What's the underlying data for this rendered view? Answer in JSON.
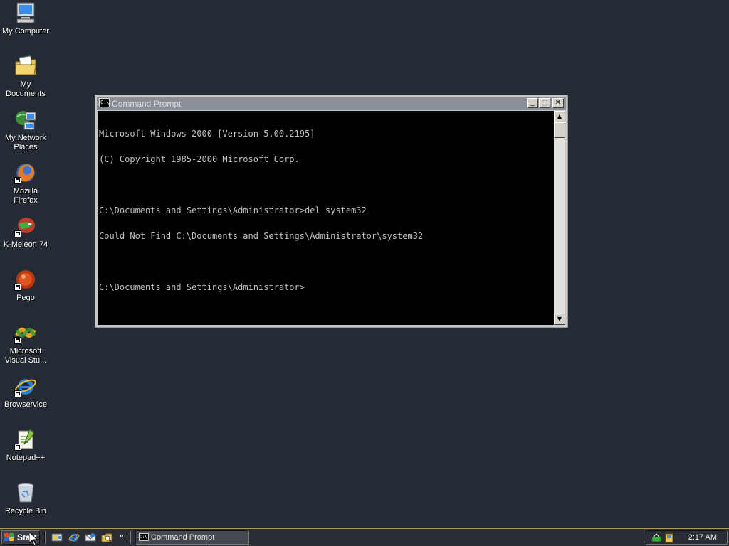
{
  "desktop": {
    "icons": [
      {
        "label": "My Computer",
        "icon": "my-computer-icon"
      },
      {
        "label": "My Documents",
        "icon": "my-documents-icon"
      },
      {
        "label": "My Network Places",
        "icon": "network-places-icon"
      },
      {
        "label": "Mozilla Firefox",
        "icon": "firefox-icon"
      },
      {
        "label": "K-Meleon 74",
        "icon": "k-meleon-icon"
      },
      {
        "label": "Pego",
        "icon": "pego-icon"
      },
      {
        "label": "Microsoft Visual Stu...",
        "icon": "visual-studio-icon"
      },
      {
        "label": "Browservice",
        "icon": "internet-explorer-icon"
      },
      {
        "label": "Notepad++",
        "icon": "notepad-plus-plus-icon"
      },
      {
        "label": "Recycle Bin",
        "icon": "recycle-bin-icon"
      }
    ]
  },
  "window": {
    "title": "Command Prompt",
    "icon_text": "C:\\",
    "controls": {
      "minimize": "_",
      "maximize": "□",
      "close": "✕"
    },
    "console_lines": [
      "Microsoft Windows 2000 [Version 5.00.2195]",
      "(C) Copyright 1985-2000 Microsoft Corp.",
      "",
      "C:\\Documents and Settings\\Administrator>del system32",
      "Could Not Find C:\\Documents and Settings\\Administrator\\system32",
      "",
      "C:\\Documents and Settings\\Administrator>"
    ],
    "scrollbar": {
      "up": "▲",
      "down": "▼"
    }
  },
  "taskbar": {
    "start_label": "Start",
    "quick_launch_more": "»",
    "tasks": [
      {
        "label": "Command Prompt",
        "icon_text": "C:\\"
      }
    ],
    "clock": "2:17 AM"
  },
  "colors": {
    "desktop": "#252b35",
    "title_inactive": "#8a8f96",
    "console_bg": "#000000",
    "console_fg": "#c0c0c0"
  }
}
